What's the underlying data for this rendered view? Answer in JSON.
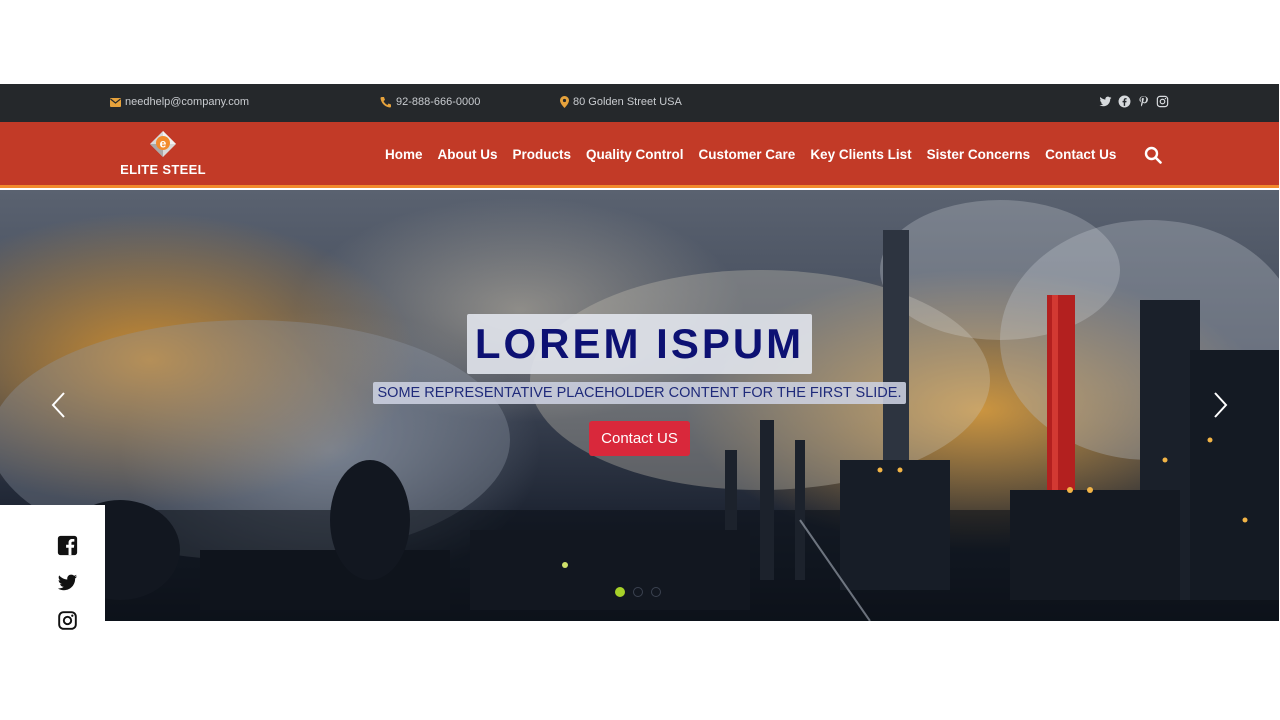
{
  "topbar": {
    "email": "needhelp@company.com",
    "phone": "92-888-666-0000",
    "address": "80 Golden Street USA",
    "email_icon": "envelope-icon",
    "phone_icon": "phone-icon",
    "address_icon": "map-marker-icon",
    "social": [
      "twitter-icon",
      "facebook-icon",
      "pinterest-icon",
      "instagram-icon"
    ]
  },
  "brand": {
    "name": "ELITE STEEL",
    "logo_letter": "e"
  },
  "nav": {
    "items": [
      {
        "label": "Home"
      },
      {
        "label": "About Us"
      },
      {
        "label": "Products"
      },
      {
        "label": "Quality Control"
      },
      {
        "label": "Customer Care"
      },
      {
        "label": "Key Clients List"
      },
      {
        "label": "Sister Concerns"
      },
      {
        "label": "Contact Us"
      }
    ],
    "search_icon": "search-icon"
  },
  "hero": {
    "headline": "LOREM ISPUM",
    "subtitle": "SOME REPRESENTATIVE PLACEHOLDER CONTENT FOR THE FIRST SLIDE.",
    "cta_label": "Contact US",
    "slides_total": 3,
    "active_slide": 1
  },
  "side_social": [
    "facebook-square-icon",
    "twitter-icon",
    "instagram-icon"
  ],
  "colors": {
    "topbar_bg": "#25282b",
    "nav_bg": "#c23a27",
    "nav_border": "#f28b2c",
    "accent_button": "#d9283b",
    "active_dot": "#a7d129",
    "headline_text": "#0d1173"
  }
}
